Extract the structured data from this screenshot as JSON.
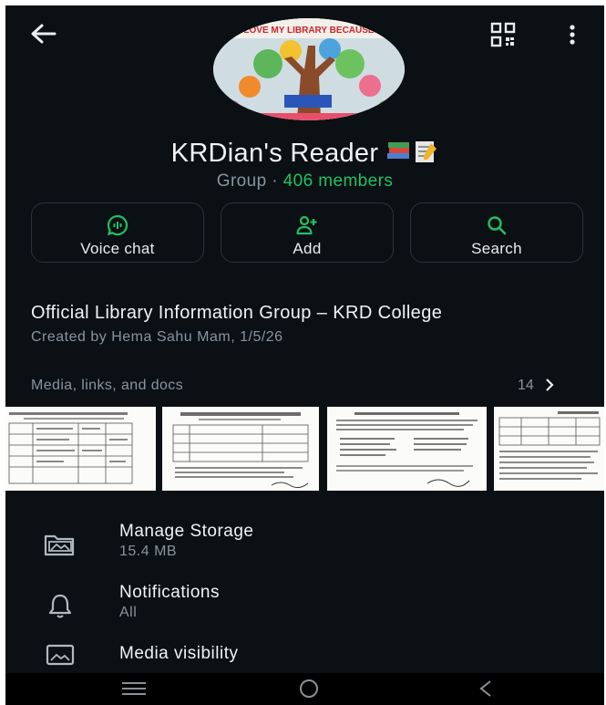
{
  "header": {
    "back_icon": "arrow-left-icon",
    "qr_icon": "qr-code-icon",
    "more_icon": "more-vertical-icon",
    "avatar_text": "LOVE MY LIBRARY BECAUSE"
  },
  "group": {
    "name": "KRDian's Reader",
    "type_label": "Group · ",
    "members_label": "406 members",
    "description": "Official Library Information Group – KRD College",
    "created": "Created by Hema Sahu Mam, 1/5/26"
  },
  "actions": [
    {
      "label": "Voice chat",
      "icon": "voice-chat-icon"
    },
    {
      "label": "Add",
      "icon": "add-person-icon"
    },
    {
      "label": "Search",
      "icon": "search-icon"
    }
  ],
  "media": {
    "header": "Media, links, and docs",
    "count": "14"
  },
  "settings": [
    {
      "title": "Manage Storage",
      "subtitle": "15.4 MB",
      "icon": "storage-folder-icon"
    },
    {
      "title": "Notifications",
      "subtitle": "All",
      "icon": "bell-icon"
    },
    {
      "title": "Media visibility",
      "subtitle": "",
      "icon": "image-icon"
    }
  ],
  "colors": {
    "background": "#0b1014",
    "accent_green": "#21c063",
    "secondary_text": "#8696a0",
    "button_border": "#2a3439"
  }
}
